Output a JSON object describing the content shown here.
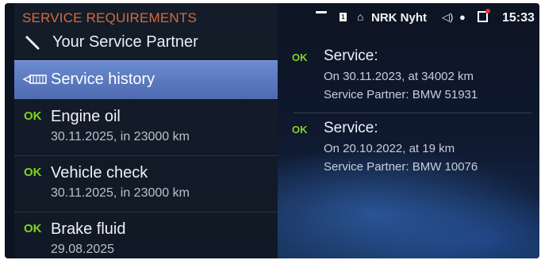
{
  "menu": {
    "title": "SERVICE REQUIREMENTS",
    "partner": {
      "label": "Your Service Partner",
      "icon": "wrench-icon"
    },
    "history": {
      "label": "Service history",
      "icon": "service-book-icon"
    },
    "items": [
      {
        "status": "OK",
        "title": "Engine oil",
        "detail": "30.11.2025, in 23000 km"
      },
      {
        "status": "OK",
        "title": "Vehicle check",
        "detail": "30.11.2025, in 23000 km"
      },
      {
        "status": "OK",
        "title": "Brake fluid",
        "detail": "29.08.2025"
      }
    ]
  },
  "status_bar": {
    "sim_label": "1",
    "station": "NRK Nyht",
    "time": "15:33",
    "icons": [
      "sim-icon",
      "radio-icon",
      "volume-icon",
      "microphone-icon",
      "message-icon"
    ]
  },
  "history_entries": [
    {
      "status": "OK",
      "title": "Service:",
      "line1": "On 30.11.2023, at 34002 km",
      "line2": "Service Partner: BMW 51931"
    },
    {
      "status": "OK",
      "title": "Service:",
      "line1": "On 20.10.2022, at 19 km",
      "line2": "Service Partner: BMW 10076"
    }
  ],
  "colors": {
    "ok_green": "#7fd321",
    "title_orange": "#d86a3a",
    "selection_blue": "#5a78be"
  }
}
